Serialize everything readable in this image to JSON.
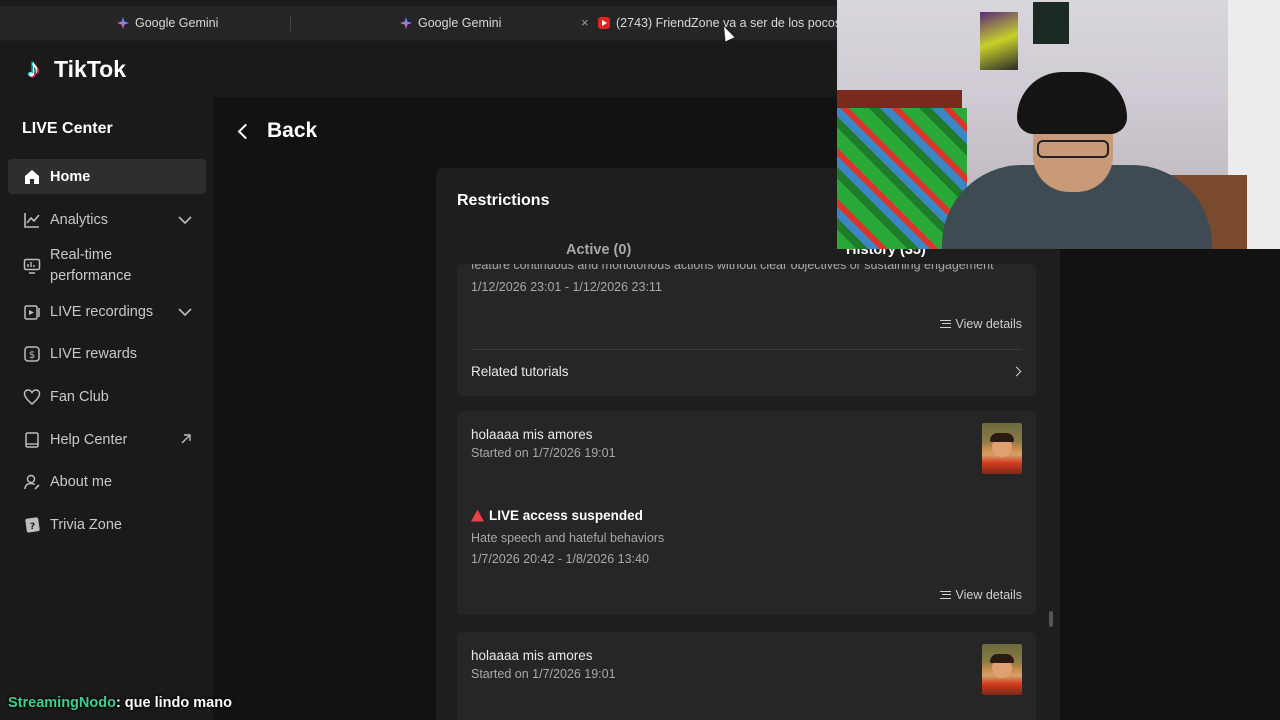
{
  "browser": {
    "tabs": [
      {
        "label": "Google Gemini",
        "favicon": "gemini-icon"
      },
      {
        "label": "Google Gemini",
        "favicon": "gemini-icon"
      },
      {
        "label": "(2743) FriendZone va a ser de los pocos",
        "favicon": "youtube-icon"
      }
    ],
    "close_glyph": "×"
  },
  "brand": {
    "name": "TikTok"
  },
  "sidebar": {
    "section_title": "LIVE Center",
    "items": [
      {
        "label": "Home",
        "icon": "home-icon",
        "active": true
      },
      {
        "label": "Analytics",
        "icon": "chart-icon",
        "trail": "chevron-down-icon"
      },
      {
        "label": "Real-time performance",
        "icon": "monitor-icon"
      },
      {
        "label": "LIVE recordings",
        "icon": "recording-icon",
        "trail": "chevron-down-icon"
      },
      {
        "label": "LIVE rewards",
        "icon": "dollar-coin-icon"
      },
      {
        "label": "Fan Club",
        "icon": "heart-badge-icon"
      },
      {
        "label": "Help Center",
        "icon": "book-icon",
        "trail": "external-link-icon"
      },
      {
        "label": "About me",
        "icon": "user-edit-icon"
      },
      {
        "label": "Trivia Zone",
        "icon": "trivia-icon"
      }
    ]
  },
  "main": {
    "back_label": "Back",
    "panel": {
      "title": "Restrictions",
      "tabs": [
        {
          "label": "Active (0)",
          "selected": false
        },
        {
          "label": "History (35)",
          "selected": true
        }
      ],
      "card1": {
        "clipped_text": "feature continuous and monotonous actions without clear objectives or sustaining engagement",
        "date_range": "1/12/2026 23:01 - 1/12/2026 23:11",
        "view_details": "View details",
        "related_tutorials": "Related tutorials"
      },
      "card2": {
        "stream_title": "holaaaa mis amores",
        "started": "Started on 1/7/2026 19:01",
        "status": "LIVE access suspended",
        "reason": "Hate speech and hateful behaviors",
        "date_range": "1/7/2026 20:42 - 1/8/2026 13:40",
        "view_details": "View details"
      },
      "card3": {
        "stream_title": "holaaaa mis amores",
        "started": "Started on 1/7/2026 19:01"
      }
    }
  },
  "chat": {
    "user": "StreamingNodo",
    "message": ": que lindo mano"
  },
  "colors": {
    "accent_warning": "#e9404c",
    "chat_user": "#3fd08f",
    "background": "#121212"
  }
}
